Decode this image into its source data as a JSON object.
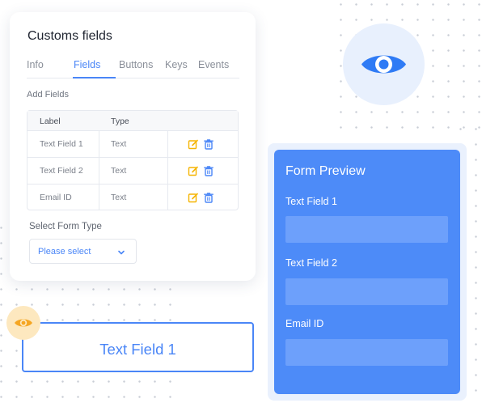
{
  "card": {
    "title": "Customs fields",
    "tabs": [
      {
        "label": "Info",
        "active": false
      },
      {
        "label": "Fields",
        "active": true
      },
      {
        "label": "Buttons",
        "active": false
      },
      {
        "label": "Keys",
        "active": false
      },
      {
        "label": "Events",
        "active": false
      }
    ],
    "add_fields_label": "Add Fields",
    "table": {
      "headers": [
        "Label",
        "Type",
        ""
      ],
      "rows": [
        {
          "label": "Text Field 1",
          "type": "Text"
        },
        {
          "label": "Text Field 2",
          "type": "Text"
        },
        {
          "label": "Email ID",
          "type": "Text"
        }
      ],
      "actions": [
        "edit-icon",
        "trash-icon"
      ]
    },
    "select_form_type_label": "Select Form Type",
    "select": {
      "placeholder": "Please select"
    }
  },
  "preview": {
    "title": "Form Preview",
    "fields": [
      {
        "label": "Text Field 1",
        "value": ""
      },
      {
        "label": "Text Field 2",
        "value": ""
      },
      {
        "label": "Email ID",
        "value": ""
      }
    ]
  },
  "text_field_box": {
    "label": "Text Field 1"
  },
  "colors": {
    "accent": "#4a86f7",
    "preview_bg": "#4d8bf8",
    "preview_input": "#6da0fb",
    "eye_circle_bg": "#e8f0fd",
    "eye_small_bg": "#fde8bf",
    "eye_small_fg": "#f5a623",
    "edit_icon": "#f5b400",
    "trash_icon": "#4a86f7"
  },
  "icons": [
    "eye-icon",
    "edit-icon",
    "trash-icon",
    "chevron-down-icon"
  ]
}
